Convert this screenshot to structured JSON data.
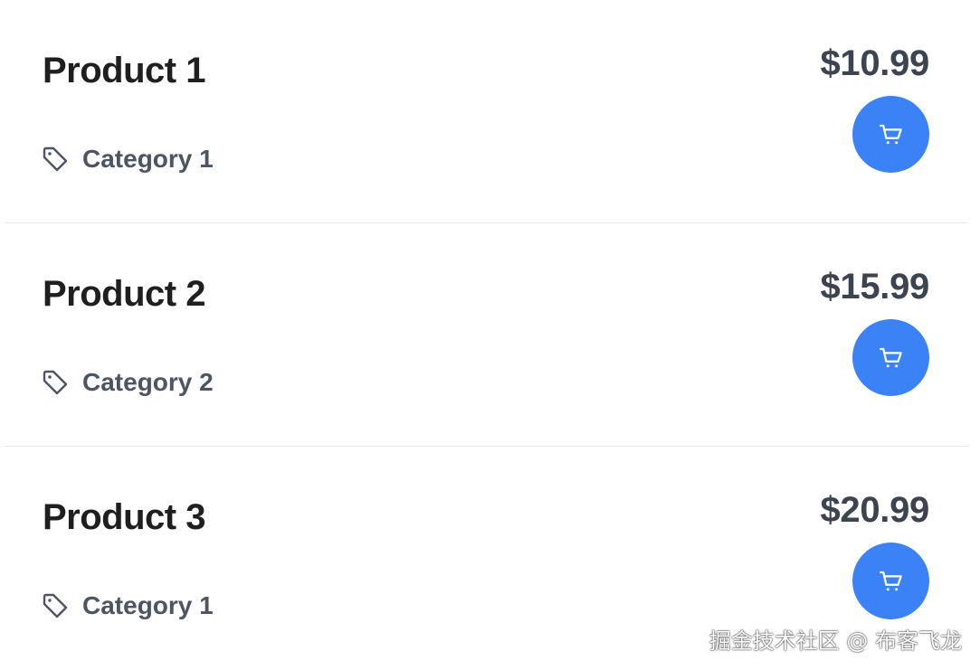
{
  "products": [
    {
      "name": "Product 1",
      "category": "Category 1",
      "price": "$10.99"
    },
    {
      "name": "Product 2",
      "category": "Category 2",
      "price": "$15.99"
    },
    {
      "name": "Product 3",
      "category": "Category 1",
      "price": "$20.99"
    }
  ],
  "icons": {
    "category": "tag-icon",
    "add_to_cart": "shopping-cart-icon"
  },
  "colors": {
    "accent": "#3b82f6",
    "title": "#1f1f1f",
    "secondary_text": "#4b5563",
    "divider": "#e5e7eb"
  },
  "watermark": "掘金技术社区 @ 布客飞龙"
}
